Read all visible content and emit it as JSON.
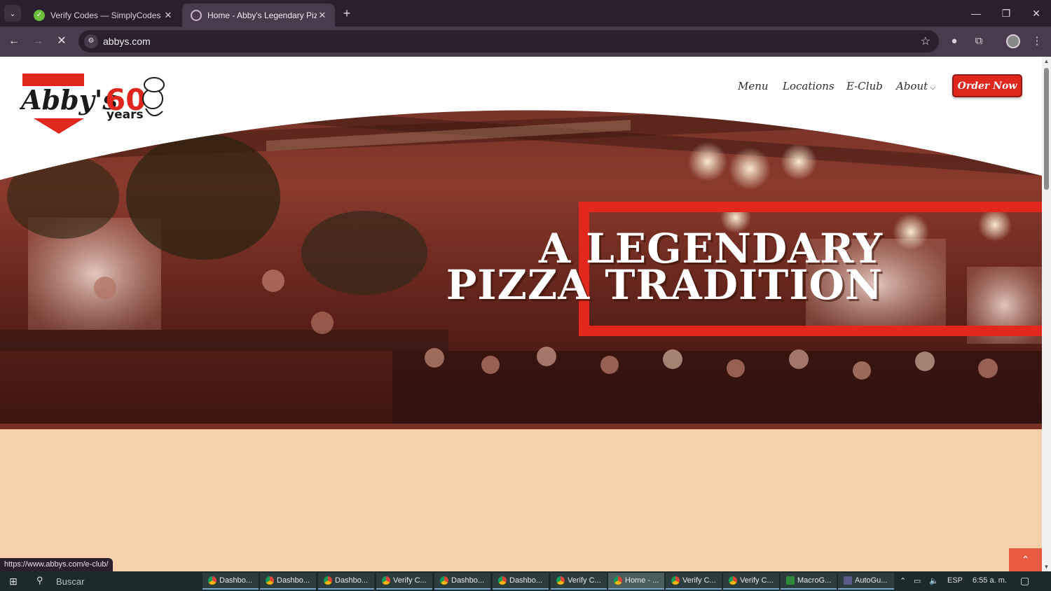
{
  "browser": {
    "tabs": [
      {
        "title": "Verify Codes — SimplyCodes",
        "active": false
      },
      {
        "title": "Home - Abby's Legendary Pizza",
        "active": true
      }
    ],
    "url": "abbys.com",
    "status_url": "https://www.abbys.com/e-club/"
  },
  "site": {
    "logo_text": "Abby's",
    "anniversary_number": "60",
    "anniversary_word": "years",
    "nav": {
      "menu": "Menu",
      "locations": "Locations",
      "eclub": "E-Club",
      "about": "About"
    },
    "order_button": "Order Now",
    "hero": {
      "line1": "A LEGENDARY",
      "line2": "PIZZA TRADITION"
    },
    "colors": {
      "brand_red": "#e2271c",
      "page_bg": "#f6cfab",
      "band": "#7a2e22"
    }
  },
  "taskbar": {
    "search_placeholder": "Buscar",
    "items": [
      {
        "label": "Dashbo...",
        "icon": "chrome-icon"
      },
      {
        "label": "Dashbo...",
        "icon": "chrome-icon"
      },
      {
        "label": "Dashbo...",
        "icon": "chrome-icon"
      },
      {
        "label": "Verify C...",
        "icon": "chrome-icon"
      },
      {
        "label": "Dashbo...",
        "icon": "chrome-icon"
      },
      {
        "label": "Dashbo...",
        "icon": "chrome-icon"
      },
      {
        "label": "Verify C...",
        "icon": "chrome-icon"
      },
      {
        "label": "Home - ...",
        "icon": "chrome-icon"
      },
      {
        "label": "Verify C...",
        "icon": "chrome-icon"
      },
      {
        "label": "Verify C...",
        "icon": "chrome-icon"
      },
      {
        "label": "MacroG...",
        "icon": "macro-icon"
      },
      {
        "label": "AutoGu...",
        "icon": "autogui-icon"
      }
    ],
    "language": "ESP",
    "time": "6:55 a. m."
  }
}
